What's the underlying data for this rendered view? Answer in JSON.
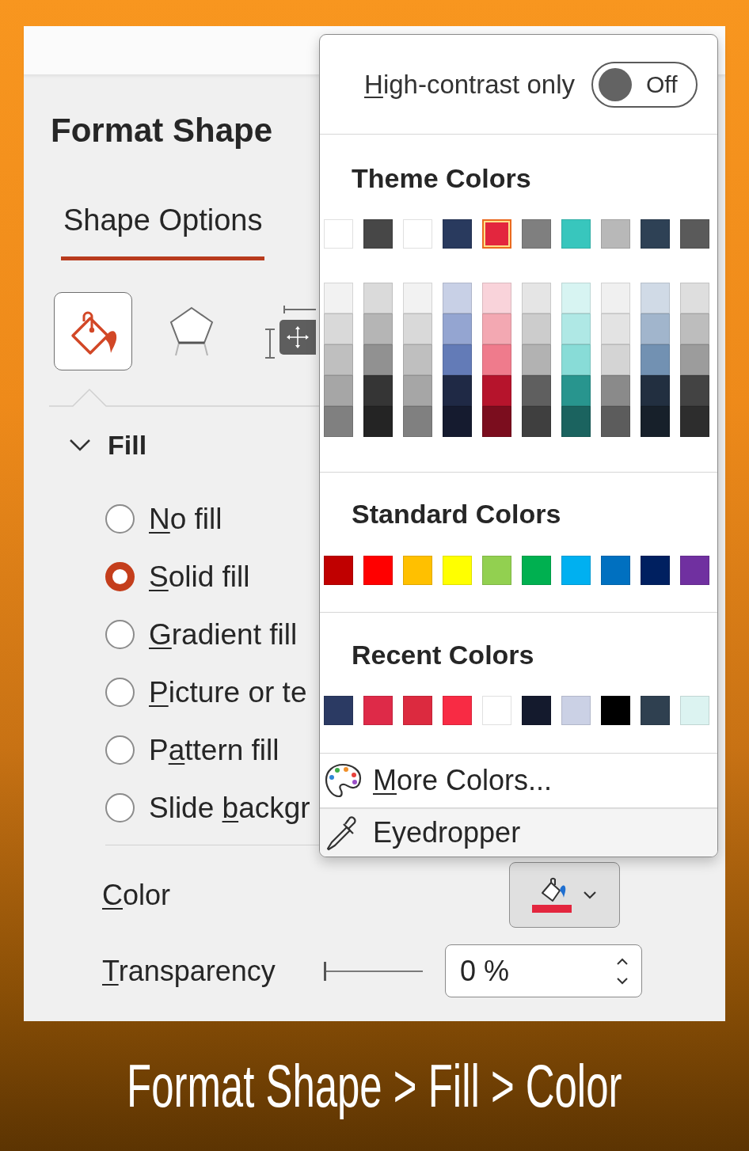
{
  "pane": {
    "title": "Format Shape"
  },
  "tabs": [
    {
      "label": "Shape Options",
      "selected": true
    }
  ],
  "categories": [
    {
      "kind": "fill",
      "selected": true
    },
    {
      "kind": "effects",
      "selected": false
    },
    {
      "kind": "size",
      "selected": false
    }
  ],
  "fill": {
    "title": "Fill",
    "expanded": true,
    "options": [
      {
        "label": [
          {
            "text": "N",
            "underline": true
          },
          {
            "text": "o fill",
            "underline": false
          }
        ],
        "selected": false
      },
      {
        "label": [
          {
            "text": "S",
            "underline": true
          },
          {
            "text": "olid fill",
            "underline": false
          }
        ],
        "selected": true
      },
      {
        "label": [
          {
            "text": "G",
            "underline": true
          },
          {
            "text": "radient fill",
            "underline": false
          }
        ],
        "selected": false
      },
      {
        "label": [
          {
            "text": "P",
            "underline": true
          },
          {
            "text": "icture or te",
            "underline": false
          }
        ],
        "selected": false
      },
      {
        "label": [
          {
            "text": "P",
            "underline": false
          },
          {
            "text": "a",
            "underline": true
          },
          {
            "text": "ttern fill",
            "underline": false
          }
        ],
        "selected": false
      },
      {
        "label": [
          {
            "text": "Slide ",
            "underline": false
          },
          {
            "text": "b",
            "underline": true
          },
          {
            "text": "ackgr",
            "underline": false
          }
        ],
        "selected": false
      }
    ]
  },
  "color": {
    "label": [
      {
        "text": "C",
        "underline": true
      },
      {
        "text": "olor",
        "underline": false
      }
    ],
    "color": "#e3263e"
  },
  "transparency": {
    "label": [
      {
        "text": "T",
        "underline": true
      },
      {
        "text": "ransparency",
        "underline": false
      }
    ],
    "level": 0,
    "value": "0 %"
  },
  "color_picker": {
    "high_contrast": {
      "label": [
        {
          "text": "H",
          "underline": true
        },
        {
          "text": "igh-contrast only",
          "underline": false
        }
      ],
      "on": false,
      "state_label": "Off"
    },
    "theme_colors": {
      "title": "Theme Colors",
      "swatches": [
        {
          "color": "#ffffff",
          "selected": false,
          "shades": [
            {
              "color": "#f2f2f2",
              "selected": false
            },
            {
              "color": "#d9d9d9",
              "selected": false
            },
            {
              "color": "#bfbfbf",
              "selected": false
            },
            {
              "color": "#a6a6a6",
              "selected": false
            },
            {
              "color": "#808080",
              "selected": false
            }
          ]
        },
        {
          "color": "#474747",
          "selected": false,
          "shades": [
            {
              "color": "#dadada",
              "selected": false
            },
            {
              "color": "#b5b5b5",
              "selected": false
            },
            {
              "color": "#919191",
              "selected": false
            },
            {
              "color": "#353535",
              "selected": false
            },
            {
              "color": "#242424",
              "selected": false
            }
          ]
        },
        {
          "color": "#ffffff",
          "selected": false,
          "shades": [
            {
              "color": "#f2f2f2",
              "selected": false
            },
            {
              "color": "#d9d9d9",
              "selected": false
            },
            {
              "color": "#bfbfbf",
              "selected": false
            },
            {
              "color": "#a6a6a6",
              "selected": false
            },
            {
              "color": "#808080",
              "selected": false
            }
          ]
        },
        {
          "color": "#293a5e",
          "selected": false,
          "shades": [
            {
              "color": "#c8d0e6",
              "selected": false
            },
            {
              "color": "#94a5d1",
              "selected": false
            },
            {
              "color": "#637bb7",
              "selected": false
            },
            {
              "color": "#1f2945",
              "selected": false
            },
            {
              "color": "#151b2f",
              "selected": false
            }
          ]
        },
        {
          "color": "#e3263e",
          "selected": true,
          "shades": [
            {
              "color": "#f9d3da",
              "selected": false
            },
            {
              "color": "#f3a8b2",
              "selected": false
            },
            {
              "color": "#ef7b8c",
              "selected": false
            },
            {
              "color": "#b6142c",
              "selected": false
            },
            {
              "color": "#7b0d1e",
              "selected": false
            }
          ]
        },
        {
          "color": "#7f7f7f",
          "selected": false,
          "shades": [
            {
              "color": "#e5e5e5",
              "selected": false
            },
            {
              "color": "#cccccc",
              "selected": false
            },
            {
              "color": "#b2b2b2",
              "selected": false
            },
            {
              "color": "#5f5f5f",
              "selected": false
            },
            {
              "color": "#3f3f3f",
              "selected": false
            }
          ]
        },
        {
          "color": "#38c6bd",
          "selected": false,
          "shades": [
            {
              "color": "#d7f4f2",
              "selected": false
            },
            {
              "color": "#afe8e5",
              "selected": false
            },
            {
              "color": "#88dcd7",
              "selected": false
            },
            {
              "color": "#28958e",
              "selected": false
            },
            {
              "color": "#1b635f",
              "selected": false
            }
          ]
        },
        {
          "color": "#b8b8b8",
          "selected": false,
          "shades": [
            {
              "color": "#f0f0f0",
              "selected": false
            },
            {
              "color": "#e3e3e3",
              "selected": false
            },
            {
              "color": "#d4d4d4",
              "selected": false
            },
            {
              "color": "#8a8a8a",
              "selected": false
            },
            {
              "color": "#5c5c5c",
              "selected": false
            }
          ]
        },
        {
          "color": "#2e4155",
          "selected": false,
          "shades": [
            {
              "color": "#d0dae6",
              "selected": false
            },
            {
              "color": "#a1b5cc",
              "selected": false
            },
            {
              "color": "#7291b2",
              "selected": false
            },
            {
              "color": "#222f40",
              "selected": false
            },
            {
              "color": "#17202a",
              "selected": false
            }
          ]
        },
        {
          "color": "#5a5a5a",
          "selected": false,
          "shades": [
            {
              "color": "#dedede",
              "selected": false
            },
            {
              "color": "#bdbdbd",
              "selected": false
            },
            {
              "color": "#9c9c9c",
              "selected": false
            },
            {
              "color": "#434343",
              "selected": false
            },
            {
              "color": "#2d2d2d",
              "selected": false
            }
          ]
        }
      ]
    },
    "standard_colors": {
      "title": "Standard Colors",
      "swatches": [
        {
          "color": "#c00000",
          "selected": false
        },
        {
          "color": "#ff0000",
          "selected": false
        },
        {
          "color": "#ffc000",
          "selected": false
        },
        {
          "color": "#ffff00",
          "selected": false
        },
        {
          "color": "#92d050",
          "selected": false
        },
        {
          "color": "#00b050",
          "selected": false
        },
        {
          "color": "#00b0f0",
          "selected": false
        },
        {
          "color": "#0070c0",
          "selected": false
        },
        {
          "color": "#002060",
          "selected": false
        },
        {
          "color": "#7030a0",
          "selected": false
        }
      ]
    },
    "recent_colors": {
      "title": "Recent Colors",
      "swatches": [
        {
          "color": "#2b3a63",
          "selected": false
        },
        {
          "color": "#de2a48",
          "selected": false
        },
        {
          "color": "#dc2a3f",
          "selected": false
        },
        {
          "color": "#f82b44",
          "selected": false
        },
        {
          "color": "#ffffff",
          "selected": false
        },
        {
          "color": "#141a2d",
          "selected": false
        },
        {
          "color": "#cbd1e5",
          "selected": false
        },
        {
          "color": "#000000",
          "selected": false
        },
        {
          "color": "#2f4050",
          "selected": false
        },
        {
          "color": "#dcf3f1",
          "selected": false
        }
      ]
    },
    "actions": [
      {
        "kind": "palette",
        "label": [
          {
            "text": "M",
            "underline": true
          },
          {
            "text": "ore Colors...",
            "underline": false
          }
        ],
        "highlighted": false
      },
      {
        "kind": "eyedropper",
        "label": [
          {
            "text": "Eyedropper",
            "underline": false
          }
        ],
        "highlighted": true
      }
    ]
  },
  "caption": "Format Shape > Fill > Color"
}
